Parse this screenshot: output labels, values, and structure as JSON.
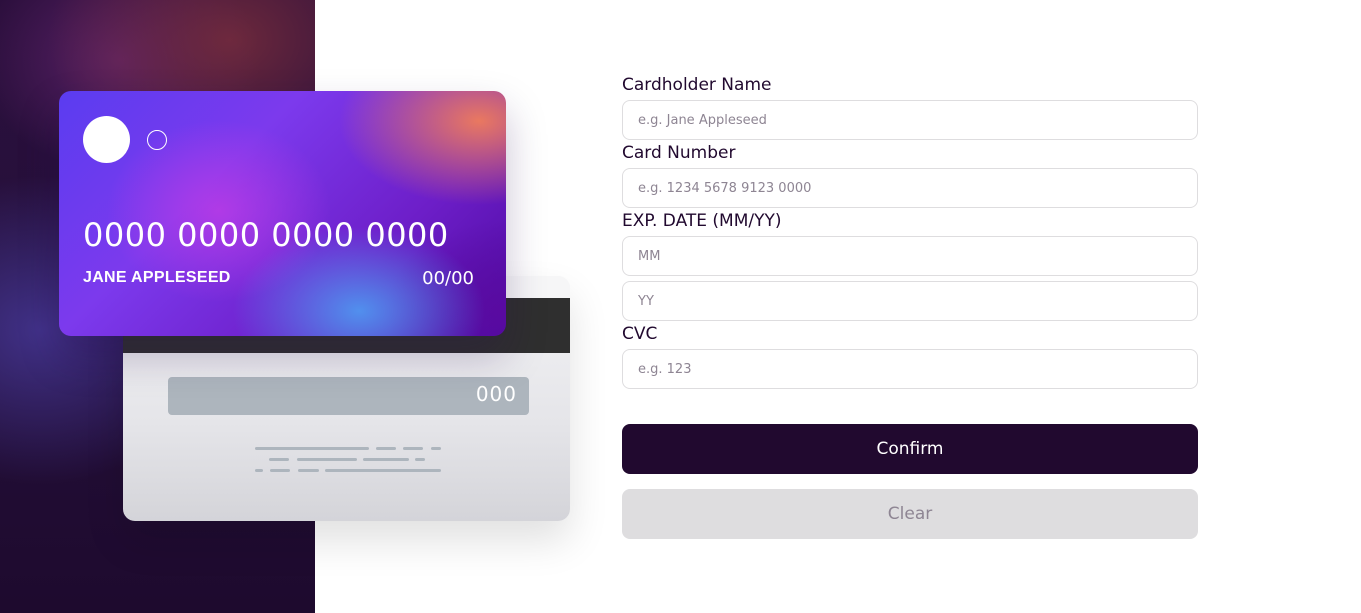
{
  "card_front": {
    "number": "0000 0000 0000 0000",
    "holder": "JANE APPLESEED",
    "expiry": "00/00"
  },
  "card_back": {
    "cvc": "000"
  },
  "form": {
    "cardholder": {
      "label": "Cardholder Name",
      "placeholder": "e.g. Jane Appleseed",
      "value": ""
    },
    "number": {
      "label": "Card Number",
      "placeholder": "e.g. 1234 5678 9123 0000",
      "value": ""
    },
    "exp_label": "EXP. DATE (MM/YY)",
    "month": {
      "placeholder": "MM",
      "value": ""
    },
    "year": {
      "placeholder": "YY",
      "value": ""
    },
    "cvc": {
      "label": "CVC",
      "placeholder": "e.g. 123",
      "value": ""
    },
    "confirm_label": "Confirm",
    "clear_label": "Clear"
  },
  "colors": {
    "dark_violet": "#21092f",
    "border_gray": "#dedddf",
    "placeholder_gray": "#8e8593"
  }
}
